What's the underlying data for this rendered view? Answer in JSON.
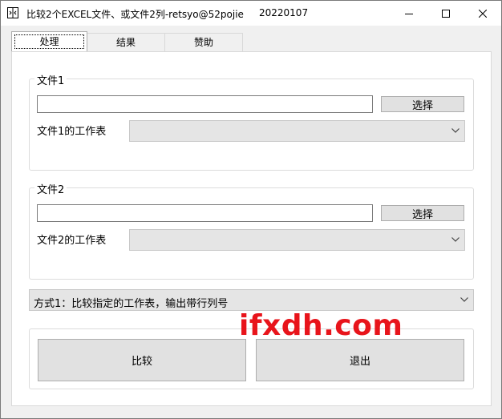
{
  "window": {
    "title": "比较2个EXCEL文件、或文件2列-retsyo@52pojie",
    "date": "20220107",
    "icon": "app-icon",
    "controls": [
      "minimize-icon",
      "maximize-icon",
      "close-icon"
    ]
  },
  "tabs": [
    {
      "label": "处理",
      "active": true
    },
    {
      "label": "结果",
      "active": false
    },
    {
      "label": "赞助",
      "active": false
    }
  ],
  "file1": {
    "group_label": "文件1",
    "path_value": "",
    "browse_label": "选择",
    "sheet_label": "文件1的工作表",
    "sheet_value": ""
  },
  "file2": {
    "group_label": "文件2",
    "path_value": "",
    "browse_label": "选择",
    "sheet_label": "文件2的工作表",
    "sheet_value": ""
  },
  "mode": {
    "selected": "方式1：比较指定的工作表，输出带行列号"
  },
  "actions": {
    "compare_label": "比较",
    "exit_label": "退出"
  },
  "watermark": "ifxdh.com",
  "colors": {
    "watermark": "#e8141b",
    "button_face": "#e1e1e1",
    "combo_face": "#e5e5e5"
  }
}
